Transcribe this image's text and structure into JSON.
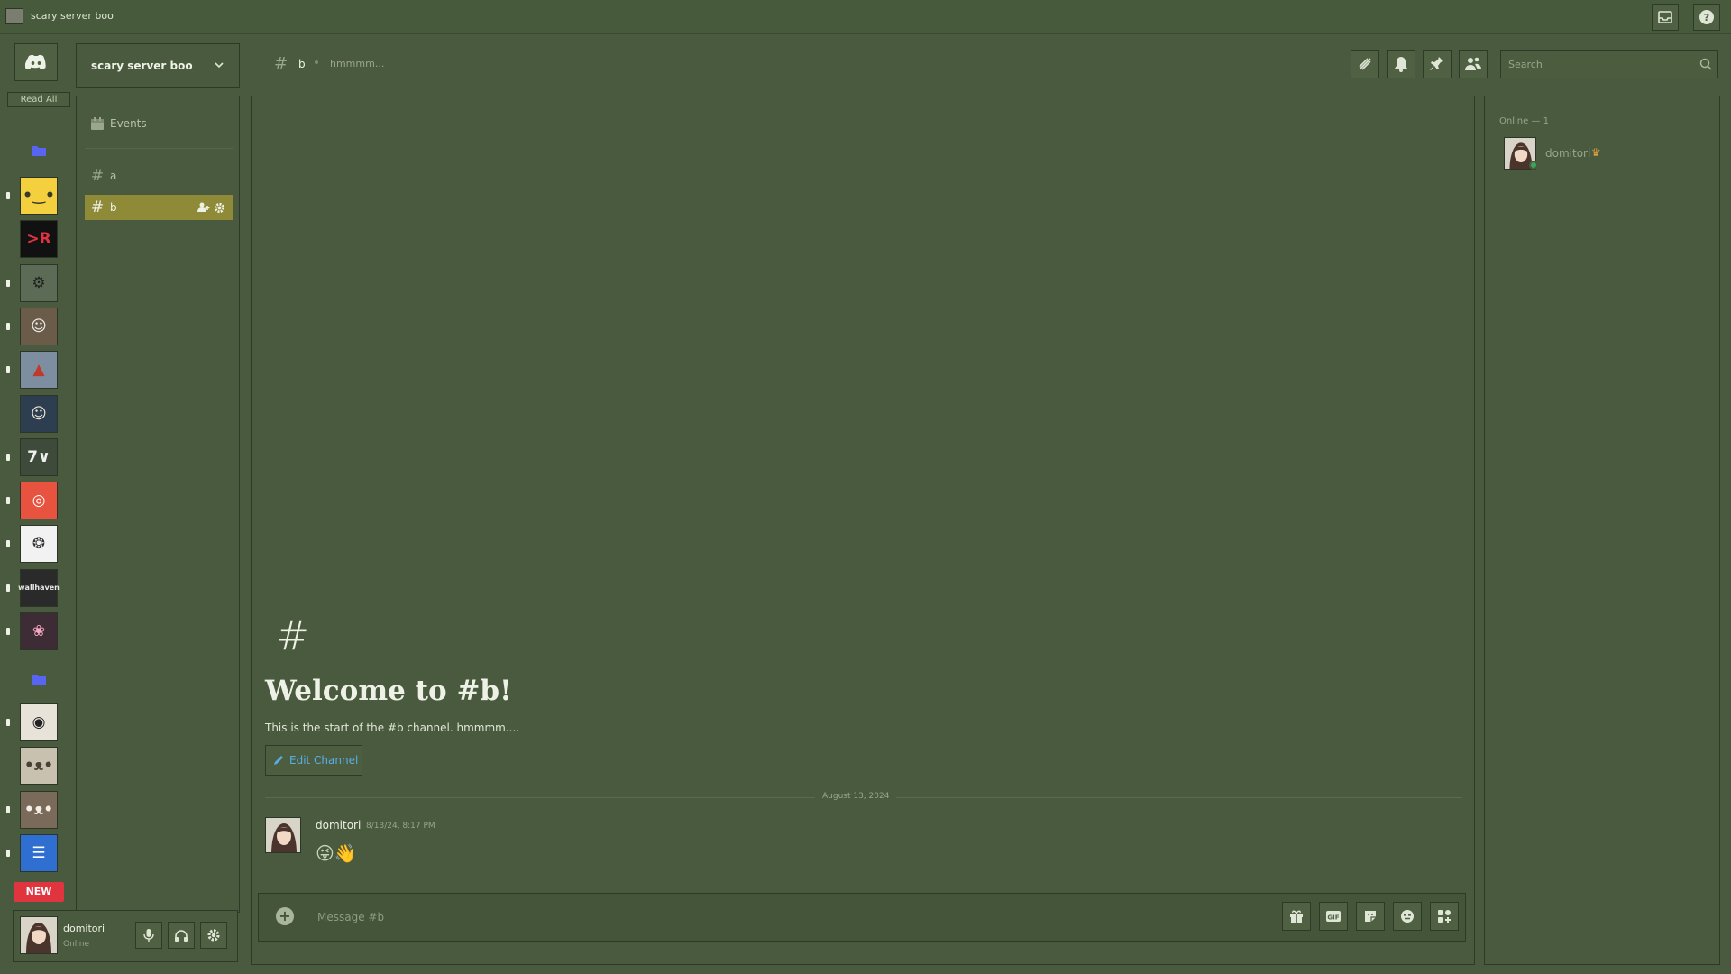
{
  "window": {
    "title": "scary server boo"
  },
  "rail": {
    "read_all": "Read All",
    "new_badge": "NEW",
    "servers": [
      {
        "name": "server-sticky-note",
        "bg": "#f4d03f",
        "glyph": "•‿•",
        "fg": "#3a3a2a"
      },
      {
        "name": "server-r-logo",
        "bg": "#111111",
        "glyph": ">R",
        "fg": "#e0343f"
      },
      {
        "name": "server-car",
        "bg": "#5c6b55",
        "glyph": "⚙",
        "fg": "#1e2320"
      },
      {
        "name": "server-artist",
        "bg": "#6b5c4a",
        "glyph": "☺",
        "fg": "#eeeeee"
      },
      {
        "name": "server-mountain",
        "bg": "#7d8ea0",
        "glyph": "▲",
        "fg": "#c0392b"
      },
      {
        "name": "server-anime-char",
        "bg": "#2c3e50",
        "glyph": "☺",
        "fg": "#f0e6d2"
      },
      {
        "name": "server-7tv",
        "bg": "#3f4b3a",
        "glyph": "7∨",
        "fg": "#f0f0f0"
      },
      {
        "name": "server-target",
        "bg": "#e8533f",
        "glyph": "◎",
        "fg": "#ffffff"
      },
      {
        "name": "server-seal",
        "bg": "#f2f2f2",
        "glyph": "❂",
        "fg": "#333333"
      },
      {
        "name": "server-wallhaven",
        "bg": "#2a2a2a",
        "glyph": "wallhaven",
        "fg": "#e8e8e8"
      },
      {
        "name": "server-pink-pig",
        "bg": "#3d2b35",
        "glyph": "❀",
        "fg": "#f4a7c0"
      }
    ],
    "servers2": [
      {
        "name": "server-speaker-eye",
        "bg": "#e8e3d8",
        "glyph": "◉",
        "fg": "#222222"
      },
      {
        "name": "server-cat",
        "bg": "#c9c1b0",
        "glyph": "•ᴥ•",
        "fg": "#4a4035"
      },
      {
        "name": "server-dog",
        "bg": "#7a6a5a",
        "glyph": "•ᴥ•",
        "fg": "#f4efe6"
      },
      {
        "name": "server-stack",
        "bg": "#2f6fd1",
        "glyph": "☰",
        "fg": "#ffffff"
      }
    ]
  },
  "server": {
    "name": "scary server boo"
  },
  "channels": {
    "events_label": "Events",
    "items": [
      {
        "name": "a"
      },
      {
        "name": "b"
      }
    ]
  },
  "header": {
    "channel_name": "b",
    "topic": "hmmmm...",
    "search_placeholder": "Search"
  },
  "welcome": {
    "title": "Welcome to #b!",
    "subtitle": "This is the start of the #b channel. hmmmm....",
    "edit_button": "Edit Channel"
  },
  "messages": {
    "date_divider": "August 13, 2024",
    "items": [
      {
        "author": "domitori",
        "timestamp": "8/13/24, 8:17 PM",
        "content": "😜👋"
      }
    ]
  },
  "composer": {
    "placeholder": "Message #b"
  },
  "members": {
    "section_label": "Online — 1",
    "items": [
      {
        "name": "domitori",
        "status": "online",
        "owner": true
      }
    ]
  },
  "user": {
    "name": "domitori",
    "status": "Online"
  },
  "colors": {
    "accent_selected": "#8f8a37",
    "link": "#5aaee8",
    "online": "#3ba55c",
    "new_badge": "#e0343f"
  }
}
